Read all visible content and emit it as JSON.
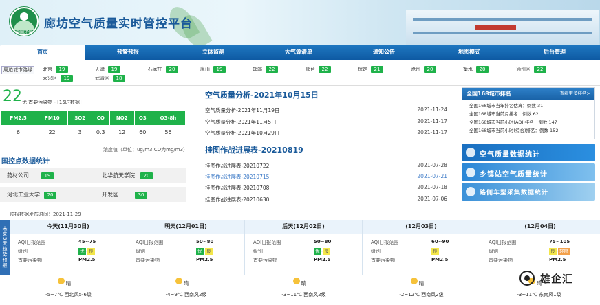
{
  "header": {
    "title": "廊坊空气质量实时管控平台",
    "logo_text": "中国环保"
  },
  "nav": [
    "首页",
    "预警预报",
    "立体监测",
    "大气源清单",
    "通知公告",
    "地图模式",
    "后台管理"
  ],
  "city_bar": {
    "nearby_label": "周边城市路缘",
    "cities": [
      {
        "name": "北京",
        "aqi": "19"
      },
      {
        "name": "大兴区",
        "aqi": "19"
      },
      {
        "name": "天津",
        "aqi": "19"
      },
      {
        "name": "武清区",
        "aqi": "18"
      },
      {
        "name": "石家庄",
        "aqi": "20"
      },
      {
        "name": "唐山",
        "aqi": "19"
      },
      {
        "name": "邯郸",
        "aqi": "22"
      },
      {
        "name": "邢台",
        "aqi": "22"
      },
      {
        "name": "保定",
        "aqi": "21"
      },
      {
        "name": "沧州",
        "aqi": "20"
      },
      {
        "name": "衡水",
        "aqi": "20"
      },
      {
        "name": "通州区",
        "aqi": "22"
      }
    ]
  },
  "current": {
    "aqi": "22",
    "level_text": "优 首要污染物 -  [15时数据]",
    "headers": [
      "PM2.5",
      "PM10",
      "SO2",
      "CO",
      "NO2",
      "O3",
      "O3-8h"
    ],
    "values": [
      "6",
      "22",
      "3",
      "0.3",
      "12",
      "60",
      "56"
    ],
    "unit_note": "浓度值（单位：ug/m3,CO为mg/m3）"
  },
  "sites": {
    "title": "国控点数据统计",
    "items": [
      {
        "name": "药材公司",
        "aqi": "19"
      },
      {
        "name": "北华航天学院",
        "aqi": "20"
      },
      {
        "name": "河北工业大学",
        "aqi": "20"
      },
      {
        "name": "开发区",
        "aqi": "30"
      }
    ]
  },
  "analysis": {
    "title": "空气质量分析-2021年10月15日",
    "items": [
      {
        "title": "空气质量分析-2021年11月19日",
        "date": "2021-11-24"
      },
      {
        "title": "空气质量分析-2021年11月5日",
        "date": "2021-11-17"
      },
      {
        "title": "空气质量分析-2021年10月29日",
        "date": "2021-11-17"
      }
    ]
  },
  "progress": {
    "title": "挂图作战进展表-20210819",
    "items": [
      {
        "title": "挂图作战进展表-20210722",
        "date": "2021-07-28"
      },
      {
        "title": "挂图作战进展表-20210715",
        "date": "2021-07-21"
      },
      {
        "title": "挂图作战进展表-20210708",
        "date": "2021-07-18"
      },
      {
        "title": "挂图作战进展表-20210630",
        "date": "2021-07-06"
      }
    ]
  },
  "ranking": {
    "title": "全国168城市排名",
    "more": "查看更多排名>",
    "lines": [
      "全国168城市当年排名估算：倒数 31",
      "全国168城市当前月排名：倒数 62",
      "全国168城市当前小时(AQI)排名：倒数 147",
      "全国168城市当前小时(综合)排名：倒数 152"
    ]
  },
  "banners": [
    "空气质量数据统计",
    "乡镇站空气质量统计",
    "路侧车型采集数据统计"
  ],
  "forecast": {
    "release": "预报数据发布时间：2021-11-29",
    "side_label": "未来5天趋势预报",
    "field_labels": [
      "AQI日报范围",
      "级别",
      "首要污染物"
    ],
    "days": [
      {
        "title": "今天(11月30日)",
        "range": "45~75",
        "levels": [
          "优",
          "良"
        ],
        "pollutant": "PM2.5",
        "weather": "晴",
        "temp_wind": "-5~7℃ 西北风5-6级"
      },
      {
        "title": "明天(12月01日)",
        "range": "50~80",
        "levels": [
          "优",
          "良"
        ],
        "pollutant": "PM2.5",
        "weather": "晴",
        "temp_wind": "-4~9℃ 西南风2级"
      },
      {
        "title": "后天(12月02日)",
        "range": "50~80",
        "levels": [
          "优",
          "良"
        ],
        "pollutant": "PM2.5",
        "weather": "晴",
        "temp_wind": "-3~11℃ 西南风2级"
      },
      {
        "title": "(12月03日)",
        "range": "60~90",
        "levels": [
          "良"
        ],
        "pollutant": "PM2.5",
        "weather": "晴",
        "temp_wind": "-2~12℃ 西南风2级"
      },
      {
        "title": "(12月04日)",
        "range": "75~105",
        "levels": [
          "良",
          "轻度"
        ],
        "pollutant": "PM2.5",
        "weather": "晴",
        "temp_wind": "-3~11℃ 东南风1级"
      }
    ]
  },
  "watermark": "雄企汇",
  "colors": {
    "good": "#1fb24a",
    "moderate": "#f3e64a",
    "light": "#f3a04a",
    "brand": "#0e5aa3"
  }
}
